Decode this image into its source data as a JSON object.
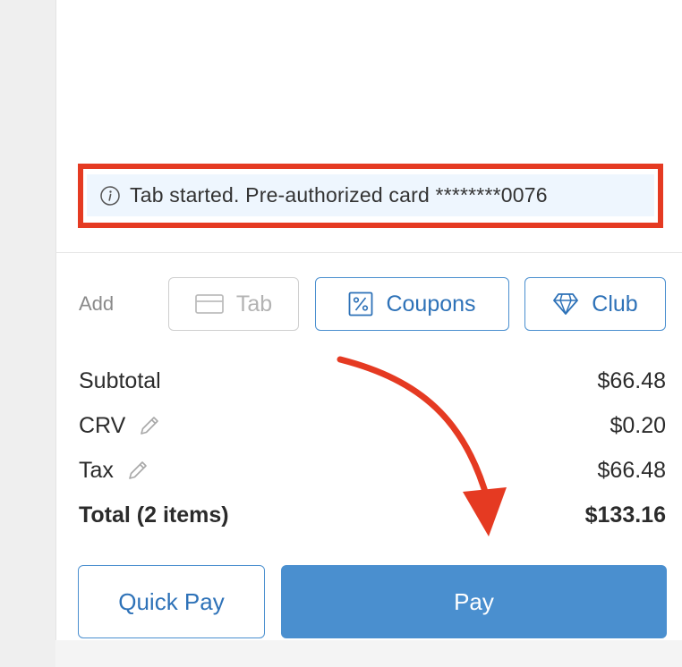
{
  "notice": {
    "text": "Tab started. Pre-authorized card ********0076",
    "icon": "info-icon"
  },
  "add_section": {
    "label": "Add",
    "chips": [
      {
        "label": "Tab",
        "icon": "card-icon",
        "enabled": false
      },
      {
        "label": "Coupons",
        "icon": "percent-icon",
        "enabled": true
      },
      {
        "label": "Club",
        "icon": "diamond-icon",
        "enabled": true
      }
    ]
  },
  "summary": {
    "subtotal": {
      "label": "Subtotal",
      "value": "$66.48"
    },
    "crv": {
      "label": "CRV",
      "value": "$0.20",
      "icon": "pencil-icon"
    },
    "tax": {
      "label": "Tax",
      "value": "$66.48",
      "icon": "pencil-icon"
    },
    "total": {
      "label": "Total (2 items)",
      "value": "$133.16"
    }
  },
  "actions": {
    "quick_pay": "Quick Pay",
    "pay": "Pay"
  },
  "colors": {
    "accent": "#4a8fcf",
    "annotation": "#e53a22",
    "notice_bg": "#eef6fe"
  }
}
